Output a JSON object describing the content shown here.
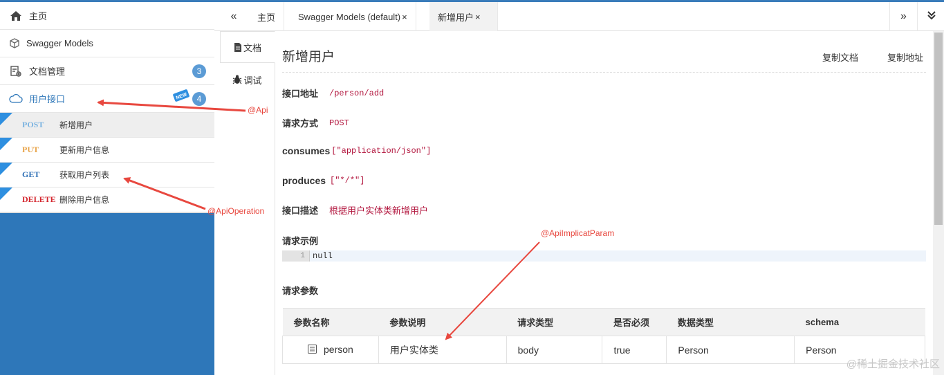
{
  "sidebar": {
    "items": [
      {
        "label": "主页",
        "icon": "home-icon"
      },
      {
        "label": "Swagger Models",
        "icon": "cubes-icon"
      },
      {
        "label": "文档管理",
        "icon": "settings-doc-icon",
        "badge": "3"
      },
      {
        "label": "用户接口",
        "icon": "cloud-api-icon",
        "badge": "4",
        "new_tag": "NEW"
      }
    ],
    "operations": [
      {
        "method": "POST",
        "label": "新增用户",
        "color": "#7bb3e0"
      },
      {
        "method": "PUT",
        "label": "更新用户信息",
        "color": "#e8a44a"
      },
      {
        "method": "GET",
        "label": "获取用户列表",
        "color": "#2e6fb5"
      },
      {
        "method": "DELETE",
        "label": "删除用户信息",
        "color": "#d4262e"
      }
    ]
  },
  "annotations": {
    "api": "@Api",
    "api_operation": "@ApiOperation",
    "api_implicit_param": "@ApiImplicatParam"
  },
  "tabs": {
    "left_nav": "«",
    "right_nav": "»",
    "menu": "⌄",
    "items": [
      {
        "label": "主页",
        "close": ""
      },
      {
        "label": "Swagger Models (default)",
        "close": "×"
      },
      {
        "label": "新增用户",
        "close": "×"
      }
    ]
  },
  "vtabs": {
    "doc": "文档",
    "debug": "调试"
  },
  "operation": {
    "title": "新增用户",
    "copy_doc": "复制文档",
    "copy_url": "复制地址",
    "url_label": "接口地址",
    "url": "/person/add",
    "method_label": "请求方式",
    "method": "POST",
    "consumes_label": "consumes",
    "consumes": "[\"application/json\"]",
    "produces_label": "produces",
    "produces": "[\"*/*\"]",
    "desc_label": "接口描述",
    "desc": "根据用户实体类新增用户",
    "example_label": "请求示例",
    "example_line_no": "1",
    "example_code": "null",
    "params_label": "请求参数"
  },
  "params": {
    "headers": [
      "参数名称",
      "参数说明",
      "请求类型",
      "是否必须",
      "数据类型",
      "schema"
    ],
    "rows": [
      {
        "name": "person",
        "desc": "用户实体类",
        "in": "body",
        "required": "true",
        "type": "Person",
        "schema": "Person"
      }
    ]
  },
  "watermark": "@稀土掘金技术社区"
}
